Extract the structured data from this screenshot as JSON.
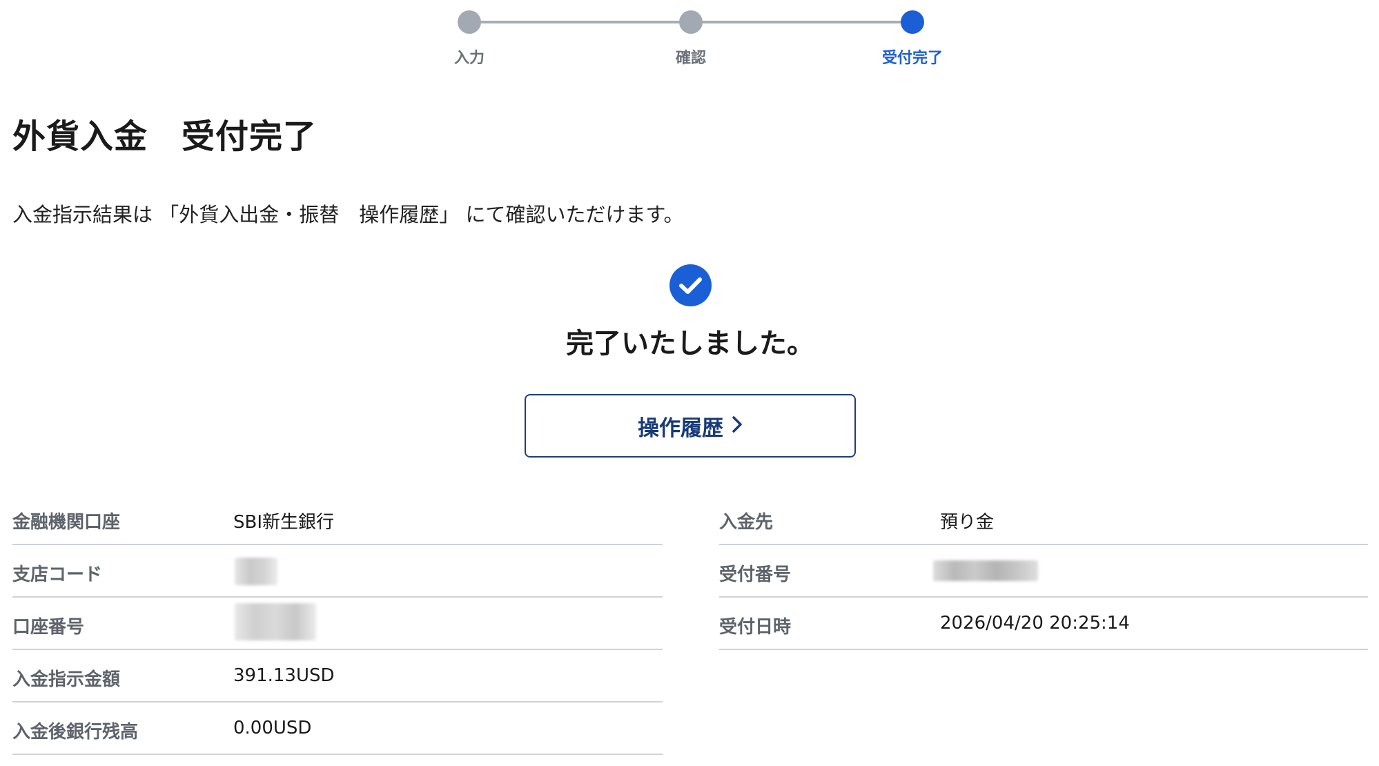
{
  "stepper": {
    "steps": [
      {
        "label": "入力",
        "state": "done"
      },
      {
        "label": "確認",
        "state": "done"
      },
      {
        "label": "受付完了",
        "state": "current"
      }
    ]
  },
  "page": {
    "title": "外貨入金　受付完了",
    "description": "入金指示結果は 「外貨入出金・振替　操作履歴」 にて確認いただけます。"
  },
  "completion": {
    "icon": "check-circle-icon",
    "message": "完了いたしました。",
    "button_label": "操作履歴",
    "button_icon": "chevron-right-icon"
  },
  "details_left": [
    {
      "key": "金融機関口座",
      "value": "SBI新生銀行"
    },
    {
      "key": "支店コード",
      "value": ""
    },
    {
      "key": "口座番号",
      "value": ""
    },
    {
      "key": "入金指示金額",
      "value": "391.13USD"
    },
    {
      "key": "入金後銀行残高",
      "value": "0.00USD"
    }
  ],
  "details_right": [
    {
      "key": "入金先",
      "value": "預り金"
    },
    {
      "key": "受付番号",
      "value": ""
    },
    {
      "key": "受付日時",
      "value": "2026/04/20 20:25:14"
    }
  ],
  "colors": {
    "accent": "#1a5fd6",
    "button_border": "#1d3e7a",
    "step_inactive": "#a3a9b3",
    "divider": "#cfd2d6"
  }
}
